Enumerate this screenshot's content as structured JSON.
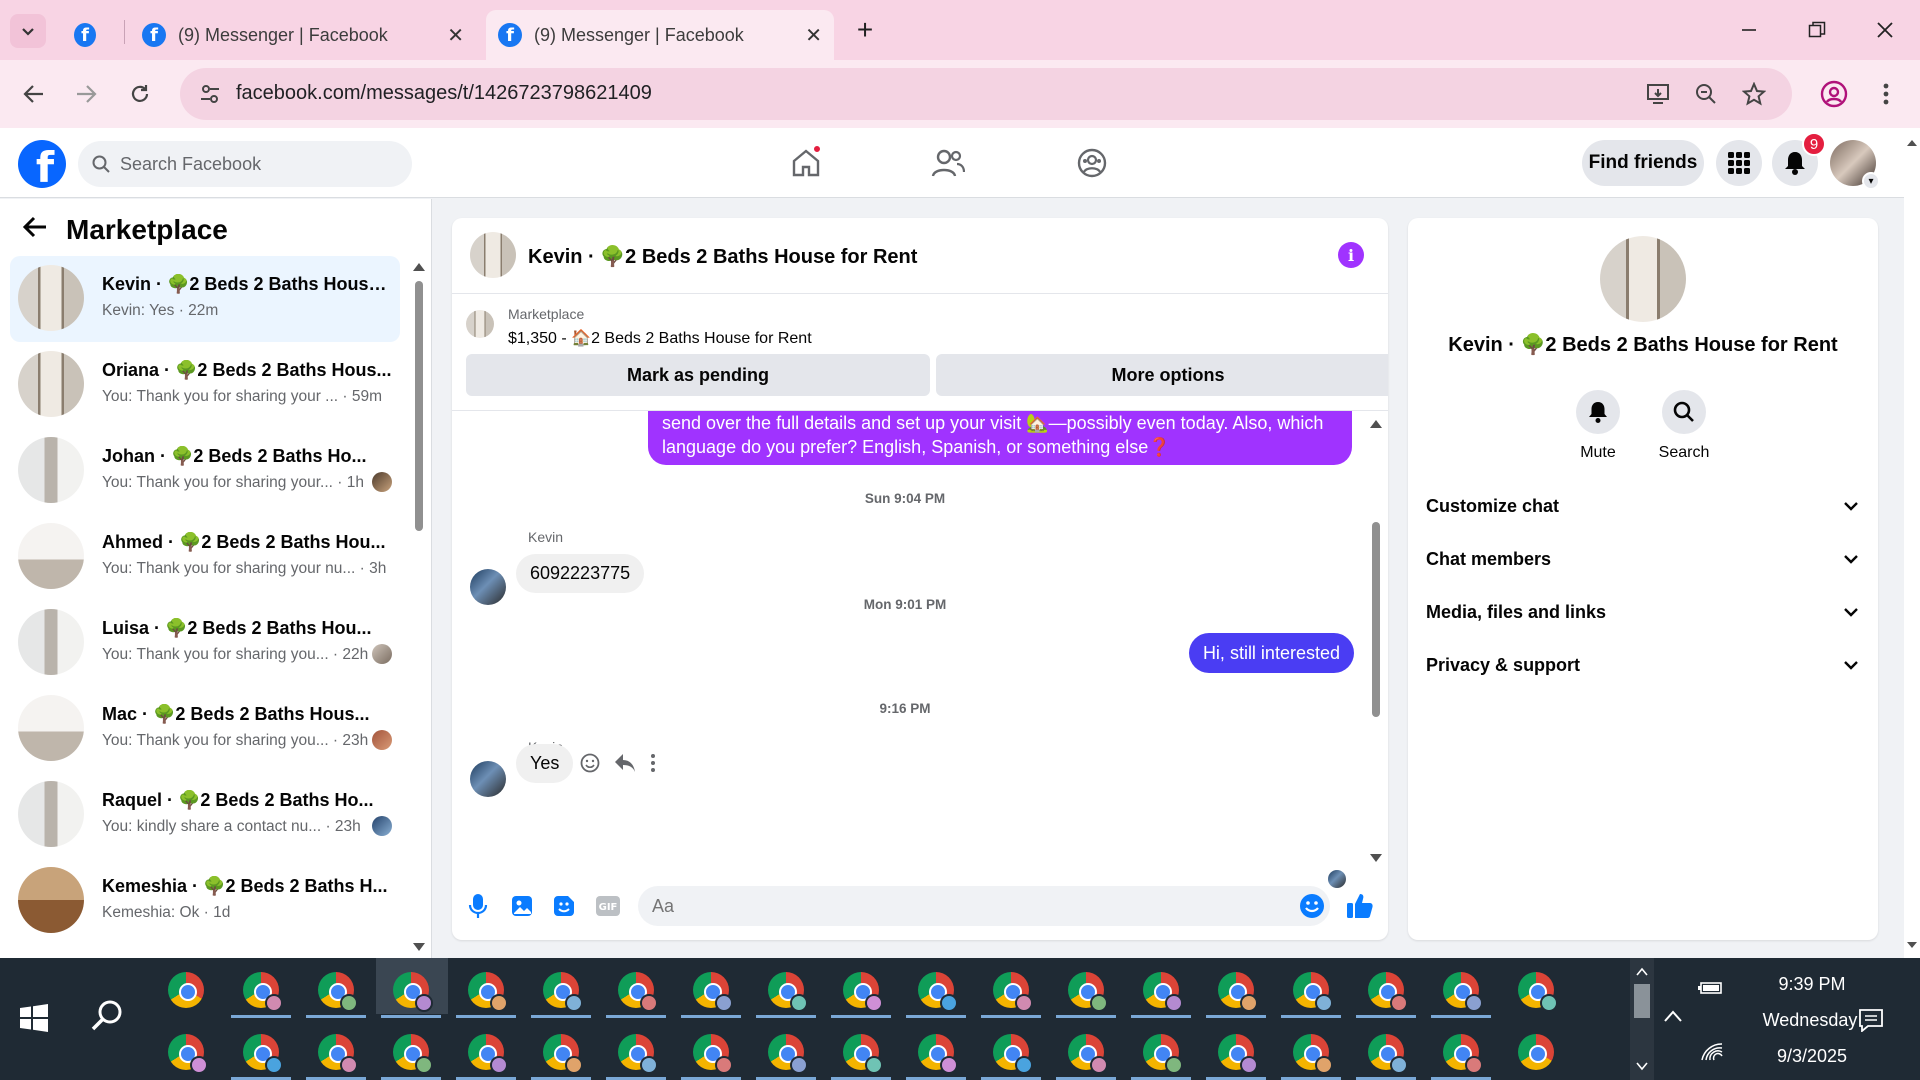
{
  "browser": {
    "tabs": [
      {
        "title": "(9) Messenger | Facebook"
      },
      {
        "title": "(9) Messenger | Facebook"
      }
    ],
    "new_tab": "+",
    "url": "facebook.com/messages/t/1426723798621409"
  },
  "fb_nav": {
    "search_placeholder": "Search Facebook",
    "find_friends": "Find friends",
    "notification_count": "9"
  },
  "chat_list": {
    "title": "Marketplace",
    "conversations": [
      {
        "name": "Kevin · 🌳2 Beds 2 Baths House...",
        "preview": "Kevin: Yes · 22m",
        "active": true
      },
      {
        "name": "Oriana · 🌳2 Beds 2 Baths Hous...",
        "preview": "You: Thank you for sharing your ... · 59m"
      },
      {
        "name": "Johan · 🌳2 Beds 2 Baths Ho...",
        "preview": "You: Thank you for sharing your... · 1h"
      },
      {
        "name": "Ahmed · 🌳2 Beds 2 Baths Hou...",
        "preview": "You: Thank you for sharing your nu... · 3h"
      },
      {
        "name": "Luisa · 🌳2 Beds 2 Baths Hou...",
        "preview": "You: Thank you for sharing you... · 22h"
      },
      {
        "name": "Mac · 🌳2 Beds 2 Baths Hous...",
        "preview": "You: Thank you for sharing you... · 23h"
      },
      {
        "name": "Raquel · 🌳2 Beds 2 Baths Ho...",
        "preview": "You: kindly share a contact nu... · 23h"
      },
      {
        "name": "Kemeshia · 🌳2 Beds 2 Baths H...",
        "preview": "Kemeshia: Ok · 1d"
      }
    ]
  },
  "conversation": {
    "title": "Kevin · 🌳2 Beds 2 Baths House for Rent",
    "marketplace_label": "Marketplace",
    "listing": "$1,350 - 🏠2 Beds 2 Baths House for Rent",
    "mark_pending": "Mark as pending",
    "more_options": "More options",
    "messages": {
      "out_long_line1": "send over the full details and set up your visit 🏡—possibly even today. Also, which",
      "out_long_line2": "language do you prefer? English, Spanish, or something else❓",
      "ts1": "Sun 9:04 PM",
      "sender1": "Kevin",
      "in1": "6092223775",
      "ts2": "Mon 9:01 PM",
      "out2": "Hi, still interested",
      "ts3": "9:16 PM",
      "sender2": "Kevin",
      "in2": "Yes"
    },
    "composer_placeholder": "Aa"
  },
  "info_panel": {
    "name": "Kevin · 🌳2 Beds 2 Baths House for Rent",
    "actions": [
      {
        "label": "Mute"
      },
      {
        "label": "Search"
      }
    ],
    "sections": [
      "Customize chat",
      "Chat members",
      "Media, files and links",
      "Privacy & support"
    ]
  },
  "taskbar": {
    "time": "9:39 PM",
    "day": "Wednesday",
    "date": "9/3/2025"
  },
  "colors": {
    "fb_blue": "#0866ff",
    "messenger_purple": "#a033ff",
    "outgoing_blue": "#4a3df3",
    "tab_bar_pink": "#f8d4e4"
  }
}
